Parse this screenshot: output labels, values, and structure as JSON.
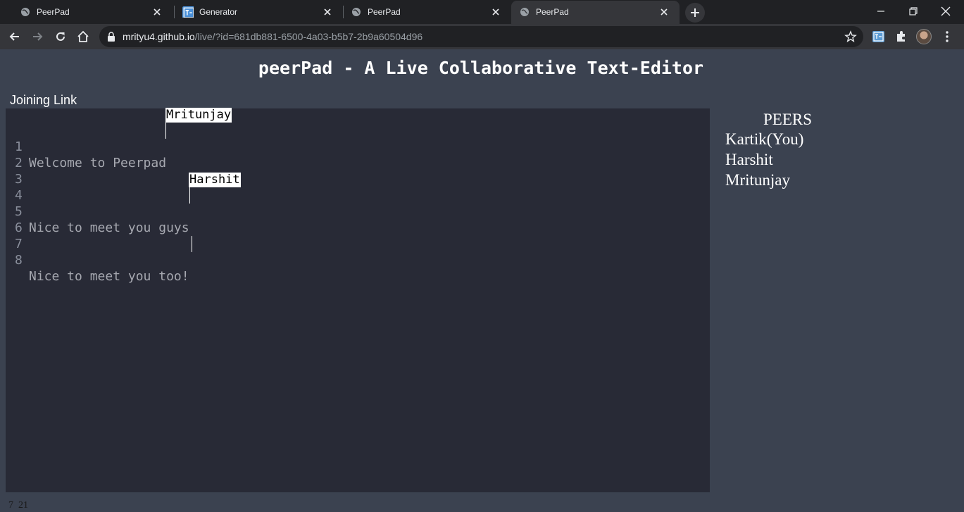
{
  "browser": {
    "tabs": [
      {
        "title": "PeerPad",
        "icon": "globe-icon",
        "active": false
      },
      {
        "title": "Generator",
        "icon": "tab-generator-icon",
        "active": false
      },
      {
        "title": "PeerPad",
        "icon": "globe-icon",
        "active": false
      },
      {
        "title": "PeerPad",
        "icon": "globe-icon",
        "active": true
      }
    ],
    "url_host": "mrityu4.github.io",
    "url_path": "/live/?id=681db881-6500-4a03-b5b7-2b9a60504d96"
  },
  "page": {
    "title": "peerPad - A Live Collaborative Text-Editor",
    "joining_link": "Joining Link"
  },
  "editor": {
    "lines": [
      {
        "num": "1",
        "text": "Welcome to Peerpad"
      },
      {
        "num": "2",
        "text": ""
      },
      {
        "num": "3",
        "text": ""
      },
      {
        "num": "4",
        "text": ""
      },
      {
        "num": "5",
        "text": "Nice to meet you guys"
      },
      {
        "num": "6",
        "text": ""
      },
      {
        "num": "7",
        "text": ""
      },
      {
        "num": "8",
        "text": "Nice to meet you too!"
      }
    ],
    "remote_cursors": [
      {
        "name": "Mritunjay",
        "line": 1
      },
      {
        "name": "Harshit",
        "line": 5
      }
    ]
  },
  "peers": {
    "title": "PEERS",
    "list": [
      "Kartik(You)",
      "Harshit",
      "Mritunjay"
    ]
  },
  "status": {
    "position": "7  21"
  },
  "colors": {
    "page_bg": "#3b4250",
    "editor_bg": "#282a36",
    "chrome_dark": "#202124",
    "chrome_toolbar": "#35363a"
  }
}
